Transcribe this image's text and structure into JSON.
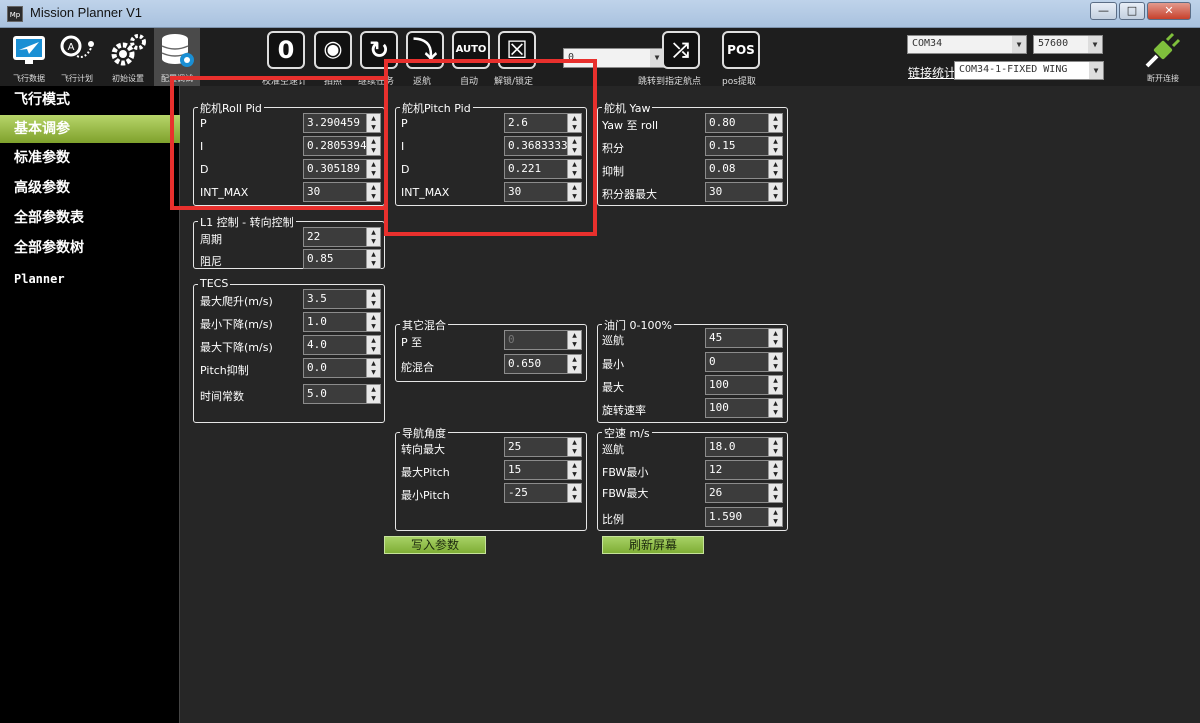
{
  "window": {
    "title": "Mission Planner V1",
    "logo_text": "Mp",
    "btn_min": "—",
    "btn_max": "□",
    "btn_close": "✕"
  },
  "toolbar": {
    "nav": [
      {
        "label": "飞行数据",
        "icon": "airplane-screen-icon"
      },
      {
        "label": "飞行计划",
        "icon": "map-pin-icon"
      },
      {
        "label": "初始设置",
        "icon": "gears-icon"
      },
      {
        "label": "配置调试",
        "icon": "database-gear-icon"
      }
    ],
    "actions": [
      {
        "glyph": "0",
        "label": "校准空速计",
        "icon": "zero-icon"
      },
      {
        "glyph": "◉",
        "label": "拍照",
        "icon": "camera-icon"
      },
      {
        "glyph": "↻",
        "label": "继续任务",
        "icon": "refresh-icon"
      },
      {
        "glyph": "⤵",
        "label": "返航",
        "icon": "return-home-icon"
      },
      {
        "glyph": "AUTO",
        "label": "自动",
        "icon": "auto-plane-icon"
      },
      {
        "glyph": "☒",
        "label": "解锁/锁定",
        "icon": "lock-icon"
      }
    ],
    "speed_value": "0",
    "jump_label": "跳转到指定航点",
    "pos_glyph": "POS",
    "pos_label": "pos提取",
    "com_port": "COM34",
    "baud": "57600",
    "link_stats_label": "链接统计",
    "connection": "COM34-1-FIXED WING",
    "disconnect_label": "断开连接"
  },
  "sidebar": {
    "items": [
      {
        "label": "飞行模式",
        "active": false
      },
      {
        "label": "基本调参",
        "active": true
      },
      {
        "label": "标准参数",
        "active": false
      },
      {
        "label": "高级参数",
        "active": false
      },
      {
        "label": "全部参数表",
        "active": false
      },
      {
        "label": "全部参数树",
        "active": false
      },
      {
        "label": "Planner",
        "active": false
      }
    ]
  },
  "groups": {
    "roll": {
      "title": "舵机Roll Pid",
      "rows": [
        {
          "label": "P",
          "value": "3.290459"
        },
        {
          "label": "I",
          "value": "0.2805394"
        },
        {
          "label": "D",
          "value": "0.305189"
        },
        {
          "label": "INT_MAX",
          "value": "30"
        }
      ]
    },
    "pitch": {
      "title": "舵机Pitch Pid",
      "rows": [
        {
          "label": "P",
          "value": "2.6"
        },
        {
          "label": "I",
          "value": "0.3683333"
        },
        {
          "label": "D",
          "value": "0.221"
        },
        {
          "label": "INT_MAX",
          "value": "30"
        }
      ]
    },
    "yaw": {
      "title": "舵机 Yaw",
      "rows": [
        {
          "label": "Yaw 至 roll",
          "value": "0.80"
        },
        {
          "label": "积分",
          "value": "0.15"
        },
        {
          "label": "抑制",
          "value": "0.08"
        },
        {
          "label": "积分器最大",
          "value": "30"
        }
      ]
    },
    "l1": {
      "title": "L1 控制 - 转向控制",
      "rows": [
        {
          "label": "周期",
          "value": "22"
        },
        {
          "label": "阻尼",
          "value": "0.85"
        }
      ]
    },
    "tecs": {
      "title": "TECS",
      "rows": [
        {
          "label": "最大爬升(m/s)",
          "value": "3.5"
        },
        {
          "label": "最小下降(m/s)",
          "value": "1.0"
        },
        {
          "label": "最大下降(m/s)",
          "value": "4.0"
        },
        {
          "label": "Pitch抑制",
          "value": "0.0"
        },
        {
          "label": "时间常数",
          "value": "5.0"
        }
      ]
    },
    "mix": {
      "title": "其它混合",
      "rows": [
        {
          "label": "P 至",
          "value": "0"
        },
        {
          "label": "舵混合",
          "value": "0.650"
        }
      ]
    },
    "throttle": {
      "title": "油门 0-100%",
      "rows": [
        {
          "label": "巡航",
          "value": "45"
        },
        {
          "label": "最小",
          "value": "0"
        },
        {
          "label": "最大",
          "value": "100"
        },
        {
          "label": "旋转速率",
          "value": "100"
        }
      ]
    },
    "nav": {
      "title": "导航角度",
      "rows": [
        {
          "label": "转向最大",
          "value": "25"
        },
        {
          "label": "最大Pitch",
          "value": "15"
        },
        {
          "label": "最小Pitch",
          "value": "-25"
        }
      ]
    },
    "airspeed": {
      "title": "空速 m/s",
      "rows": [
        {
          "label": "巡航",
          "value": "18.0"
        },
        {
          "label": "FBW最小",
          "value": "12"
        },
        {
          "label": "FBW最大",
          "value": "26"
        },
        {
          "label": "比例",
          "value": "1.590"
        }
      ]
    }
  },
  "buttons": {
    "write": "写入参数",
    "refresh": "刷新屏幕"
  },
  "colors": {
    "accent_green": "#8fbf3f",
    "highlight_red": "#e8302d"
  }
}
